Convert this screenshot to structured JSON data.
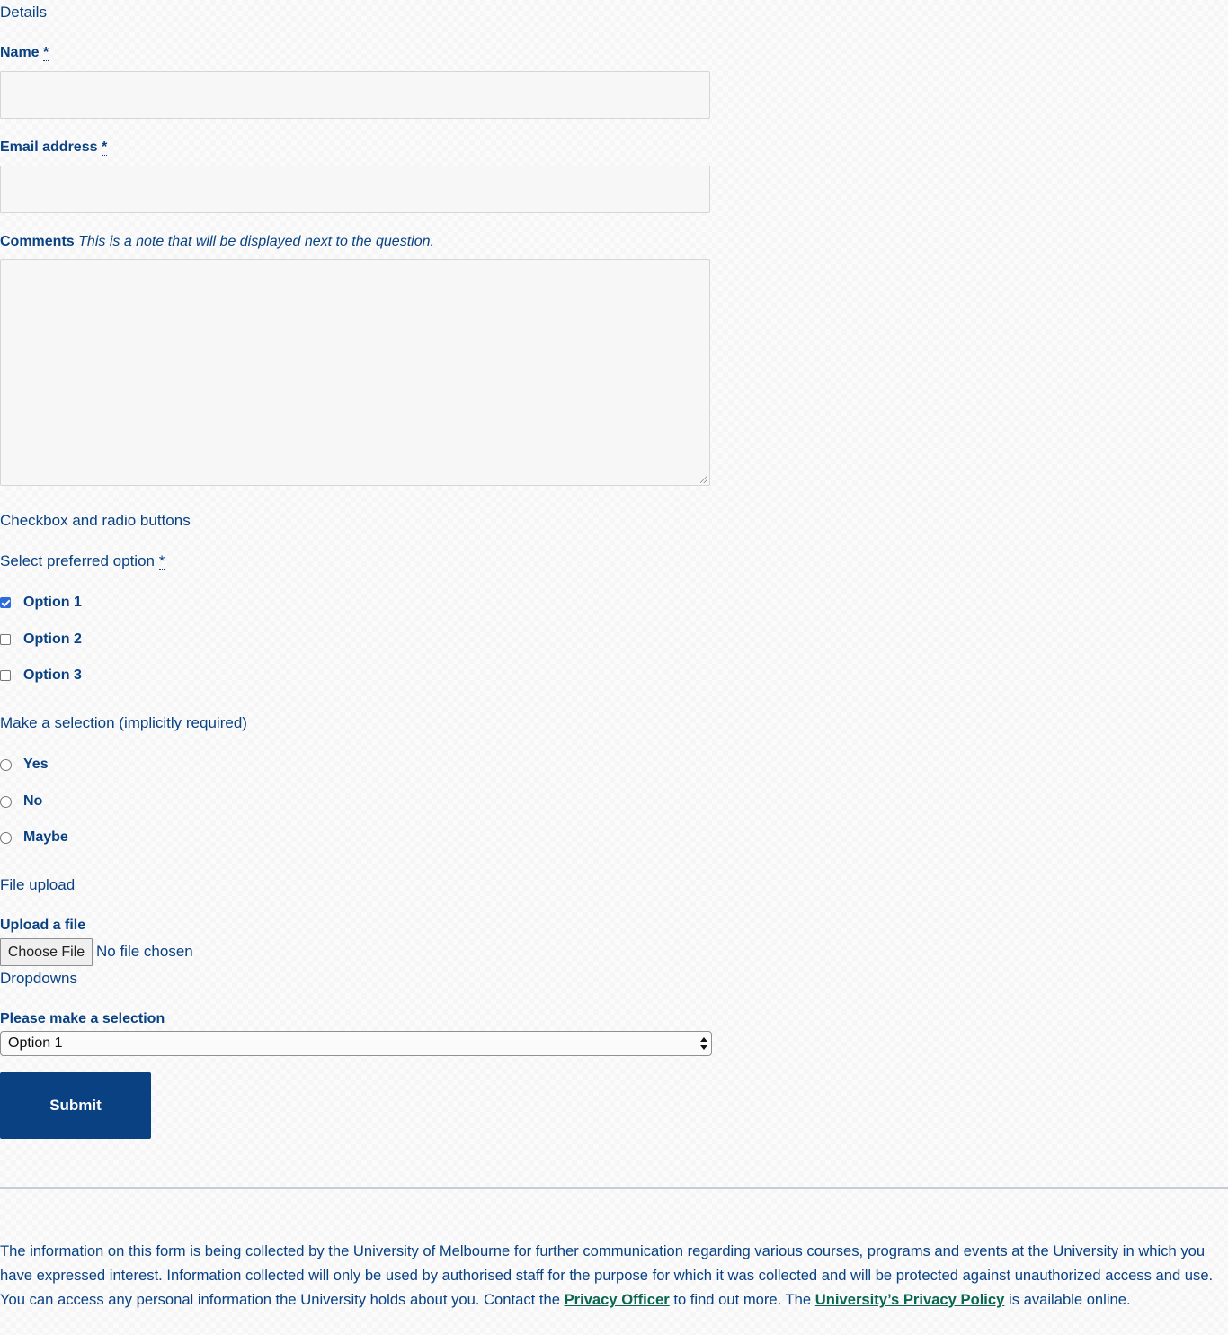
{
  "sections": {
    "details": "Details",
    "checkbox_radio": "Checkbox and radio buttons",
    "file_upload": "File upload",
    "dropdowns": "Dropdowns"
  },
  "fields": {
    "name_label": "Name",
    "email_label": "Email address",
    "required_marker": "*",
    "comments_label": "Comments",
    "comments_note": "This is a note that will be displayed next to the question.",
    "name_value": "",
    "email_value": "",
    "comments_value": ""
  },
  "checkbox_group": {
    "label": "Select preferred option",
    "options": [
      {
        "label": "Option 1",
        "checked": true
      },
      {
        "label": "Option 2",
        "checked": false
      },
      {
        "label": "Option 3",
        "checked": false
      }
    ]
  },
  "radio_group": {
    "label": "Make a selection (implicitly required)",
    "options": [
      {
        "label": "Yes",
        "checked": false
      },
      {
        "label": "No",
        "checked": false
      },
      {
        "label": "Maybe",
        "checked": false
      }
    ]
  },
  "upload": {
    "label": "Upload a file",
    "button_label": "Choose File",
    "status": "No file chosen"
  },
  "dropdown": {
    "label": "Please make a selection",
    "selected": "Option 1"
  },
  "submit_label": "Submit",
  "privacy": {
    "text_1": "The information on this form is being collected by the University of Melbourne for further communication regarding various courses, programs and events at the University in which you have expressed interest. Information collected will only be used by authorised staff for the purpose for which it was collected and will be protected against unauthorized access and use. You can access any personal information the University holds about you. Contact the ",
    "link_1": "Privacy Officer",
    "text_2": " to find out more. The ",
    "link_2": "University’s Privacy Policy",
    "text_3": " is available online."
  },
  "colors": {
    "text": "#094183",
    "button_bg": "#094183",
    "link": "#0a6650",
    "checkbox_checked": "#2c6bd8"
  }
}
